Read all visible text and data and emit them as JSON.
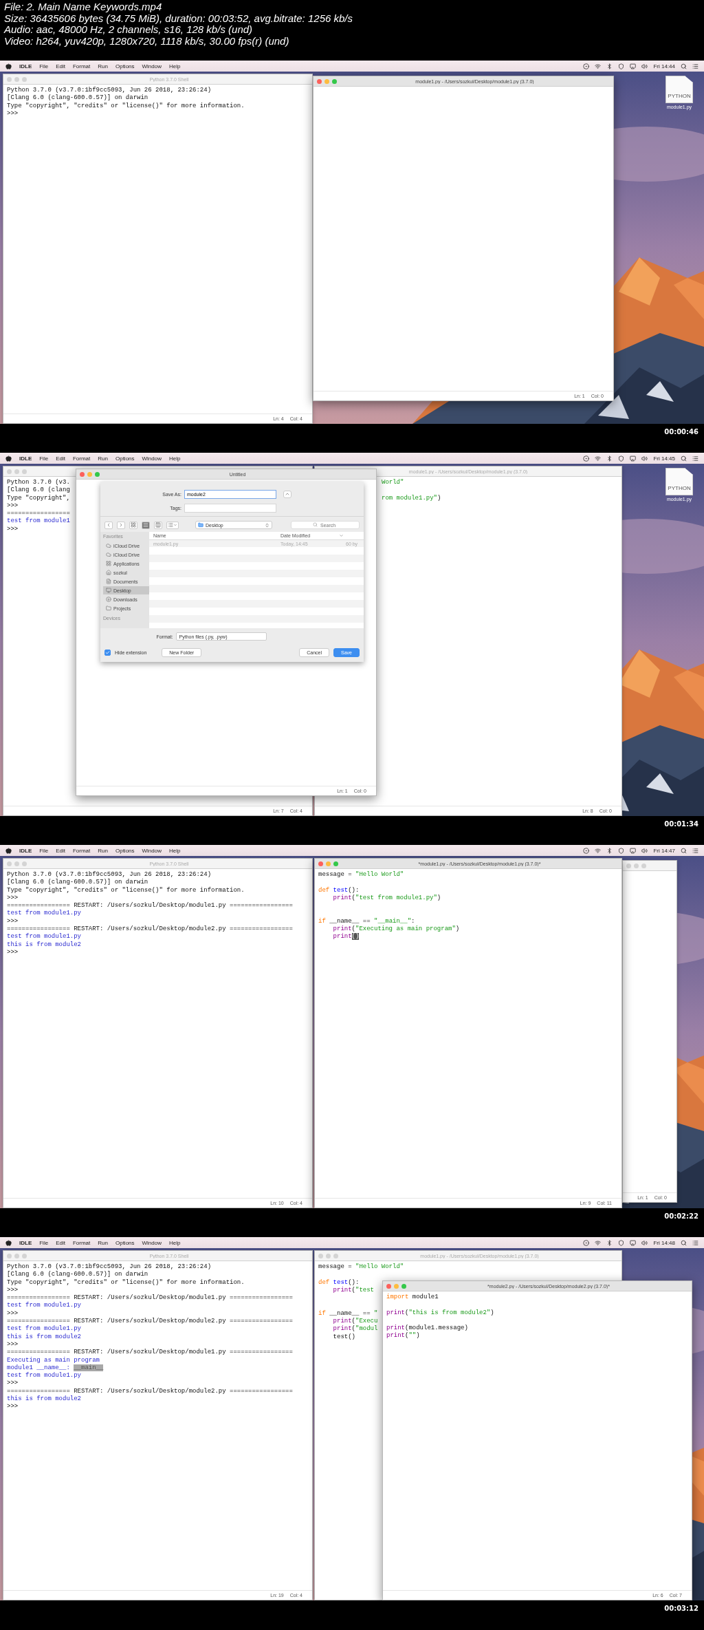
{
  "header": [
    "File: 2. Main Name Keywords.mp4",
    "Size: 36435606 bytes (34.75 MiB), duration: 00:03:52, avg.bitrate: 1256 kb/s",
    "Audio: aac, 48000 Hz, 2 channels, s16, 128 kb/s (und)",
    "Video: h264, yuv420p, 1280x720, 1118 kb/s, 30.00 fps(r) (und)"
  ],
  "frames": [
    {
      "timestamp": "00:00:46",
      "menu": {
        "app": "IDLE",
        "items": [
          "File",
          "Edit",
          "Format",
          "Run",
          "Options",
          "Window",
          "Help"
        ],
        "clock": "Fri 14:44"
      },
      "desktop_icons": [
        {
          "label": "module1.py",
          "badge": "PYTHON"
        }
      ],
      "windows": [
        {
          "kind": "shell",
          "title": "Python 3.7.0 Shell",
          "active": false,
          "status": {
            "line": "Ln: 4",
            "column": "Col: 4"
          },
          "lines": [
            {
              "kind": "plain",
              "text": "Python 3.7.0 (v3.7.0:1bf9cc5093, Jun 26 2018, 23:26:24)"
            },
            {
              "kind": "plain",
              "text": "[Clang 6.0 (clang-600.0.57)] on darwin"
            },
            {
              "kind": "plain",
              "text": "Type \"copyright\", \"credits\" or \"license()\" for more information."
            },
            {
              "kind": "plain",
              "text": ">>>"
            }
          ]
        },
        {
          "kind": "editor",
          "title": "module1.py - /Users/sozkul/Desktop/module1.py (3.7.0)",
          "active": true,
          "status": {
            "line": "Ln: 1",
            "column": "Col: 0"
          }
        }
      ]
    },
    {
      "timestamp": "00:01:34",
      "menu": {
        "app": "IDLE",
        "items": [
          "File",
          "Edit",
          "Format",
          "Run",
          "Options",
          "Window",
          "Help"
        ],
        "clock": "Fri 14:45"
      },
      "desktop_icons": [
        {
          "label": "module1.py",
          "badge": "PYTHON"
        }
      ],
      "windows": [
        {
          "kind": "shell",
          "active": false,
          "status": {
            "line": "Ln: 7",
            "column": "Col: 4"
          },
          "lines": [
            {
              "kind": "plain",
              "text": "Python 3.7.0 (v3."
            },
            {
              "kind": "plain",
              "text": "[Clang 6.0 (clang"
            },
            {
              "kind": "plain",
              "text": "Type \"copyright\","
            },
            {
              "kind": "plain",
              "text": ">>>"
            },
            {
              "kind": "plain",
              "text": "================="
            },
            {
              "kind": "output",
              "text": "test from module1"
            },
            {
              "kind": "plain",
              "text": ">>>"
            }
          ]
        },
        {
          "kind": "editor",
          "title": "module1.py - /Users/sozkul/Desktop/module1.py (3.7.0)",
          "active": false,
          "status": {
            "line": "Ln: 8",
            "column": "Col: 0"
          },
          "lines": [
            {
              "kind": "code",
              "tokens": [
                {
                  "text": "World\"",
                  "kind": "string"
                }
              ]
            },
            {
              "kind": "blank"
            },
            {
              "kind": "code",
              "tokens": [
                {
                  "text": "rom module1.py\"",
                  "kind": "string"
                },
                {
                  "text": ")",
                  "kind": "plain"
                }
              ]
            }
          ]
        },
        {
          "kind": "dialog",
          "title": "Untitled",
          "active": true,
          "status": {
            "line": "Ln: 1",
            "column": "Col: 0"
          },
          "save_sheet": {
            "save_as_label": "Save As:",
            "file_name": "module2",
            "tags_label": "Tags:",
            "views": [
              {
                "selected": false
              },
              {
                "selected": true
              },
              {
                "selected": false
              }
            ],
            "location": "Desktop",
            "search_placeholder": "Search",
            "sidebar_heading": "Favorites",
            "sidebar_items": [
              {
                "label": "iCloud Drive",
                "selected": false
              },
              {
                "label": "iCloud Drive",
                "selected": false
              },
              {
                "label": "Applications",
                "selected": false
              },
              {
                "label": "sozkul",
                "selected": false
              },
              {
                "label": "Documents",
                "selected": false
              },
              {
                "label": "Desktop",
                "selected": true
              },
              {
                "label": "Downloads",
                "selected": false
              },
              {
                "label": "Projects",
                "selected": false
              }
            ],
            "sidebar_footer": "Devices",
            "columns": [
              "Name",
              "Date Modified"
            ],
            "files": [
              {
                "name": "module1.py",
                "modified": "Today, 14:45",
                "size": "60 by"
              }
            ],
            "format_label": "Format:",
            "format": "Python files (.py, .pyw)",
            "hide_extension": {
              "label": "Hide extension",
              "checked": true
            },
            "buttons": [
              {
                "label": "New Folder",
                "kind": "normal"
              },
              {
                "label": "Cancel",
                "kind": "normal"
              },
              {
                "label": "Save",
                "kind": "default"
              }
            ]
          }
        }
      ]
    },
    {
      "timestamp": "00:02:22",
      "menu": {
        "app": "IDLE",
        "items": [
          "File",
          "Edit",
          "Format",
          "Run",
          "Options",
          "Window",
          "Help"
        ],
        "clock": "Fri 14:47"
      },
      "windows": [
        {
          "kind": "editor",
          "active": false,
          "status": {
            "line": "Ln: 1",
            "column": "Col: 0"
          }
        },
        {
          "kind": "shell",
          "title": "Python 3.7.0 Shell",
          "active": false,
          "status": {
            "line": "Ln: 10",
            "column": "Col: 4"
          },
          "lines": [
            {
              "kind": "plain",
              "text": "Python 3.7.0 (v3.7.0:1bf9cc5093, Jun 26 2018, 23:26:24)"
            },
            {
              "kind": "plain",
              "text": "[Clang 6.0 (clang-600.0.57)] on darwin"
            },
            {
              "kind": "plain",
              "text": "Type \"copyright\", \"credits\" or \"license()\" for more information."
            },
            {
              "kind": "plain",
              "text": ">>>"
            },
            {
              "kind": "plain",
              "text": "================= RESTART: /Users/sozkul/Desktop/module1.py ================="
            },
            {
              "kind": "output",
              "text": "test from module1.py"
            },
            {
              "kind": "plain",
              "text": ">>>"
            },
            {
              "kind": "plain",
              "text": "================= RESTART: /Users/sozkul/Desktop/module2.py ================="
            },
            {
              "kind": "output",
              "text": "test from module1.py"
            },
            {
              "kind": "output",
              "text": "this is from module2"
            },
            {
              "kind": "plain",
              "text": ">>>"
            }
          ]
        },
        {
          "kind": "editor",
          "title": "*module1.py - /Users/sozkul/Desktop/module1.py (3.7.0)*",
          "active": true,
          "status": {
            "line": "Ln: 9",
            "column": "Col: 11"
          },
          "lines": [
            {
              "kind": "code",
              "tokens": [
                {
                  "text": "message = ",
                  "kind": "plain"
                },
                {
                  "text": "\"Hello World\"",
                  "kind": "string"
                }
              ]
            },
            {
              "kind": "blank"
            },
            {
              "kind": "code",
              "tokens": [
                {
                  "text": "def ",
                  "kind": "keyword"
                },
                {
                  "text": "test",
                  "kind": "definition"
                },
                {
                  "text": "():",
                  "kind": "plain"
                }
              ]
            },
            {
              "kind": "code",
              "tokens": [
                {
                  "text": "    print",
                  "kind": "builtin"
                },
                {
                  "text": "(",
                  "kind": "plain"
                },
                {
                  "text": "\"test from module1.py\"",
                  "kind": "string"
                },
                {
                  "text": ")",
                  "kind": "plain"
                }
              ]
            },
            {
              "kind": "blank"
            },
            {
              "kind": "blank"
            },
            {
              "kind": "code",
              "tokens": [
                {
                  "text": "if",
                  "kind": "keyword"
                },
                {
                  "text": " __name__ == ",
                  "kind": "plain"
                },
                {
                  "text": "\"__main__\"",
                  "kind": "string"
                },
                {
                  "text": ":",
                  "kind": "plain"
                }
              ]
            },
            {
              "kind": "code",
              "tokens": [
                {
                  "text": "    print",
                  "kind": "builtin"
                },
                {
                  "text": "(",
                  "kind": "plain"
                },
                {
                  "text": "\"Executing as main program\"",
                  "kind": "string"
                },
                {
                  "text": ")",
                  "kind": "plain"
                }
              ]
            },
            {
              "kind": "code",
              "tokens": [
                {
                  "text": "    print",
                  "kind": "builtin"
                },
                {
                  "text": "()",
                  "kind": "match"
                }
              ]
            }
          ]
        }
      ]
    },
    {
      "timestamp": "00:03:12",
      "menu": {
        "app": "IDLE",
        "items": [
          "File",
          "Edit",
          "Format",
          "Run",
          "Options",
          "Window",
          "Help"
        ],
        "clock": "Fri 14:48"
      },
      "windows": [
        {
          "kind": "shell",
          "title": "Python 3.7.0 Shell",
          "active": false,
          "status": {
            "line": "Ln: 19",
            "column": "Col: 4"
          },
          "lines": [
            {
              "kind": "plain",
              "text": "Python 3.7.0 (v3.7.0:1bf9cc5093, Jun 26 2018, 23:26:24)"
            },
            {
              "kind": "plain",
              "text": "[Clang 6.0 (clang-600.0.57)] on darwin"
            },
            {
              "kind": "plain",
              "text": "Type \"copyright\", \"credits\" or \"license()\" for more information."
            },
            {
              "kind": "plain",
              "text": ">>>"
            },
            {
              "kind": "plain",
              "text": "================= RESTART: /Users/sozkul/Desktop/module1.py ================="
            },
            {
              "kind": "output",
              "text": "test from module1.py"
            },
            {
              "kind": "plain",
              "text": ">>>"
            },
            {
              "kind": "plain",
              "text": "================= RESTART: /Users/sozkul/Desktop/module2.py ================="
            },
            {
              "kind": "output",
              "text": "test from module1.py"
            },
            {
              "kind": "output",
              "text": "this is from module2"
            },
            {
              "kind": "plain",
              "text": ">>>"
            },
            {
              "kind": "plain",
              "text": "================= RESTART: /Users/sozkul/Desktop/module1.py ================="
            },
            {
              "kind": "output",
              "text": "Executing as main program"
            },
            {
              "kind": "code",
              "tokens": [
                {
                  "text": "module1 __name__: ",
                  "kind": "output"
                },
                {
                  "text": "__main__",
                  "kind": "selected"
                }
              ]
            },
            {
              "kind": "output",
              "text": "test from module1.py"
            },
            {
              "kind": "plain",
              "text": ">>>"
            },
            {
              "kind": "plain",
              "text": "================= RESTART: /Users/sozkul/Desktop/module2.py ================="
            },
            {
              "kind": "output",
              "text": "this is from module2"
            },
            {
              "kind": "plain",
              "text": ">>>"
            }
          ]
        },
        {
          "kind": "editor",
          "title": "module1.py - /Users/sozkul/Desktop/module1.py (3.7.0)",
          "active": false,
          "lines": [
            {
              "kind": "code",
              "tokens": [
                {
                  "text": "message = ",
                  "kind": "plain"
                },
                {
                  "text": "\"Hello World\"",
                  "kind": "string"
                }
              ]
            },
            {
              "kind": "blank"
            },
            {
              "kind": "code",
              "tokens": [
                {
                  "text": "def ",
                  "kind": "keyword"
                },
                {
                  "text": "test",
                  "kind": "definition"
                },
                {
                  "text": "():",
                  "kind": "plain"
                }
              ]
            },
            {
              "kind": "code",
              "tokens": [
                {
                  "text": "    print",
                  "kind": "builtin"
                },
                {
                  "text": "(",
                  "kind": "plain"
                },
                {
                  "text": "\"test",
                  "kind": "string"
                }
              ]
            },
            {
              "kind": "blank"
            },
            {
              "kind": "blank"
            },
            {
              "kind": "code",
              "tokens": [
                {
                  "text": "if",
                  "kind": "keyword"
                },
                {
                  "text": " __name__ == ",
                  "kind": "plain"
                },
                {
                  "text": "\"",
                  "kind": "string"
                }
              ]
            },
            {
              "kind": "code",
              "tokens": [
                {
                  "text": "    print",
                  "kind": "builtin"
                },
                {
                  "text": "(",
                  "kind": "plain"
                },
                {
                  "text": "\"Execu",
                  "kind": "string"
                }
              ]
            },
            {
              "kind": "code",
              "tokens": [
                {
                  "text": "    print",
                  "kind": "builtin"
                },
                {
                  "text": "(",
                  "kind": "plain"
                },
                {
                  "text": "\"modul",
                  "kind": "string"
                }
              ]
            },
            {
              "kind": "code",
              "tokens": [
                {
                  "text": "    test()",
                  "kind": "plain"
                }
              ]
            }
          ]
        },
        {
          "kind": "editor",
          "title": "*module2.py - /Users/sozkul/Desktop/module2.py (3.7.0)*",
          "active": true,
          "status": {
            "line": "Ln: 6",
            "column": "Col: 7"
          },
          "lines": [
            {
              "kind": "code",
              "tokens": [
                {
                  "text": "import",
                  "kind": "keyword"
                },
                {
                  "text": " module1",
                  "kind": "plain"
                }
              ]
            },
            {
              "kind": "blank"
            },
            {
              "kind": "code",
              "tokens": [
                {
                  "text": "print",
                  "kind": "builtin"
                },
                {
                  "text": "(",
                  "kind": "plain"
                },
                {
                  "text": "\"this is from module2\"",
                  "kind": "string"
                },
                {
                  "text": ")",
                  "kind": "plain"
                }
              ]
            },
            {
              "kind": "blank"
            },
            {
              "kind": "code",
              "tokens": [
                {
                  "text": "print",
                  "kind": "builtin"
                },
                {
                  "text": "(module1.message)",
                  "kind": "plain"
                }
              ]
            },
            {
              "kind": "code",
              "tokens": [
                {
                  "text": "print",
                  "kind": "builtin"
                },
                {
                  "text": "(",
                  "kind": "plain"
                },
                {
                  "text": "\"\"",
                  "kind": "string"
                },
                {
                  "text": ")",
                  "kind": "plain"
                }
              ]
            }
          ]
        }
      ]
    }
  ]
}
